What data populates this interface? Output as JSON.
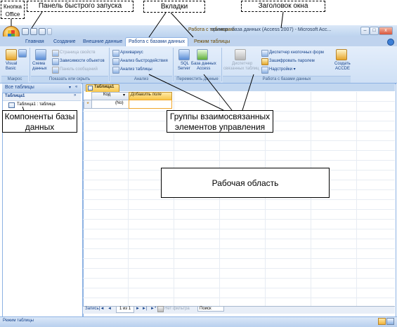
{
  "window": {
    "context_label": "Работа с таблицами",
    "title": "пример : база данных (Access 2007) - Microsoft Acc...",
    "min": "–",
    "max": "□",
    "close": "x"
  },
  "tabs": [
    {
      "label": "Главная"
    },
    {
      "label": "Создание"
    },
    {
      "label": "Внешние данные"
    },
    {
      "label": "Работа с базами данных"
    },
    {
      "label": "Режим таблицы"
    }
  ],
  "ribbon": {
    "macros": {
      "vb_line1": "Visual",
      "vb_line2": "Basic",
      "group": "Макрос"
    },
    "show_hide": {
      "schema_line1": "Схема",
      "schema_line2": "данных",
      "property_sheet": "Страница свойств",
      "object_deps": "Зависимости объектов",
      "message_bar": "Панель сообщений",
      "group": "Показать или скрыть"
    },
    "analyze": {
      "documenter": "Архивариус",
      "perf": "Анализ быстродействия",
      "table": "Анализ таблицы",
      "group": "Анализ"
    },
    "move": {
      "sql_line1": "SQL",
      "sql_line2": "Server",
      "access_line1": "База данных",
      "access_line2": "Access",
      "group": "Переместить данные"
    },
    "db_tools": {
      "split_line1": "Диспетчер",
      "split_line2": "связанных таблиц",
      "switchboard": "Диспетчер кнопочных форм",
      "encrypt": "Зашифровать паролем",
      "addins": "Надстройки ▾",
      "accde_line1": "Создать",
      "accde_line2": "ACCDE",
      "group": "Работа с базами данных"
    }
  },
  "nav": {
    "header": "Все таблицы",
    "group": "Таблица1",
    "item": "Таблица1 : таблица"
  },
  "doc": {
    "tab": "Таблица1",
    "col_id": "Код",
    "col_new": "Добавить поле",
    "row_marker": "*",
    "new_value": "(No)",
    "recnav": {
      "label": "Запись:",
      "first": "|◄",
      "prev": "◄",
      "position": "1 из 1",
      "next": "►",
      "last": "►|",
      "new": "►*",
      "filter": "Нет фильтра",
      "search": "Поиск"
    }
  },
  "status": {
    "text": "Режим таблицы"
  },
  "callouts": {
    "office_btn_line1": "Кнопка",
    "office_btn_line2": "Office",
    "qat": "Панель быстрого запуска",
    "tabs": "Вкладки",
    "title": "Заголовок окна",
    "components_line1": "Компоненты базы",
    "components_line2": "данных",
    "groups_line1": "Группы взаимосвязанных",
    "groups_line2": "элементов управления",
    "workarea": "Рабочая область"
  }
}
